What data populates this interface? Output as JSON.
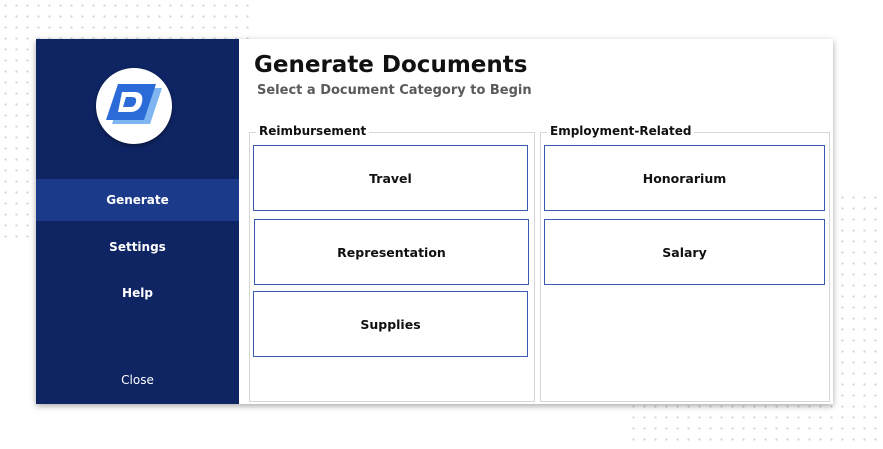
{
  "sidebar": {
    "logo_icon": "document-d-logo",
    "items": [
      {
        "label": "Generate",
        "active": true
      },
      {
        "label": "Settings",
        "active": false
      },
      {
        "label": "Help",
        "active": false
      }
    ],
    "close_label": "Close"
  },
  "header": {
    "title": "Generate Documents",
    "subtitle": "Select a Document Category to Begin"
  },
  "groups": [
    {
      "label": "Reimbursement",
      "buttons": [
        "Travel",
        "Representation",
        "Supplies"
      ]
    },
    {
      "label": "Employment-Related",
      "buttons": [
        "Honorarium",
        "Salary"
      ]
    }
  ],
  "colors": {
    "sidebar_bg": "#0f2563",
    "sidebar_active": "#1b3b8a",
    "button_border": "#3b5ab0",
    "logo_blue": "#2a6bd8"
  }
}
